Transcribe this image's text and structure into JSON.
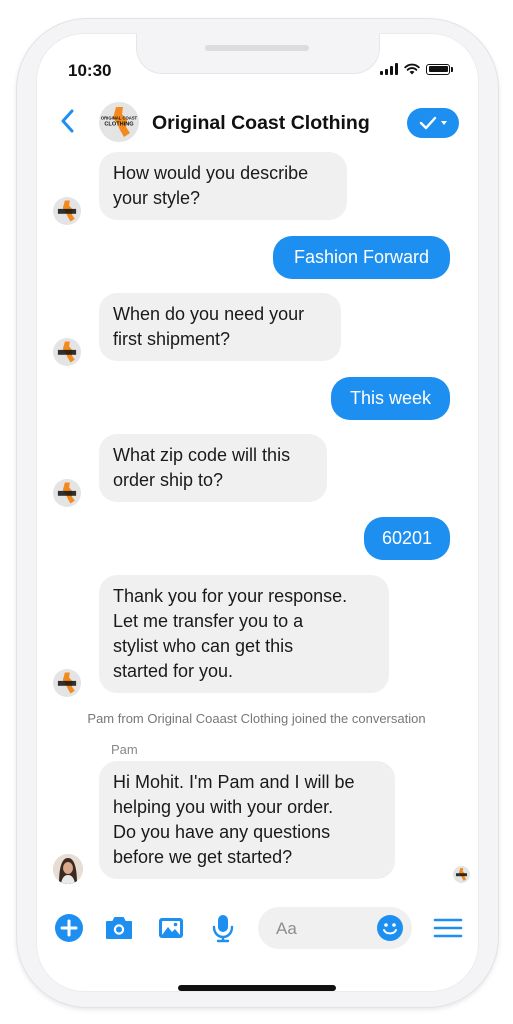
{
  "status_bar": {
    "time": "10:30"
  },
  "header": {
    "title": "Original Coast Clothing",
    "logo_text": [
      "ORIGINAL COAST",
      "CLOTHING"
    ]
  },
  "messages": [
    {
      "from": "bot",
      "lines": [
        "How would you describe",
        "your style?"
      ]
    },
    {
      "from": "user",
      "text": "Fashion Forward"
    },
    {
      "from": "bot",
      "lines": [
        "When do you need your",
        "first shipment?"
      ]
    },
    {
      "from": "user",
      "text": "This week"
    },
    {
      "from": "bot",
      "lines": [
        "What zip code will this",
        "order ship to?"
      ]
    },
    {
      "from": "user",
      "text": "60201"
    },
    {
      "from": "bot",
      "lines": [
        "Thank you for your response.",
        "Let me transfer you to a",
        "stylist who can get this",
        "started for you."
      ]
    },
    {
      "from": "agent",
      "sender": "Pam",
      "lines": [
        "Hi Mohit. I'm Pam and I will be",
        "helping you with your order.",
        "Do you have any questions",
        "before we get started?"
      ]
    }
  ],
  "system_notice": "Pam from Original Coaast Clothing joined the conversation",
  "composer": {
    "placeholder": "Aa",
    "icons": [
      "plus-icon",
      "camera-icon",
      "image-icon",
      "microphone-icon",
      "emoji-icon",
      "menu-icon"
    ]
  },
  "colors": {
    "accent": "#1d8ff0",
    "bubble_in": "#f0f0f0",
    "logo_orange": "#f28a1e"
  }
}
